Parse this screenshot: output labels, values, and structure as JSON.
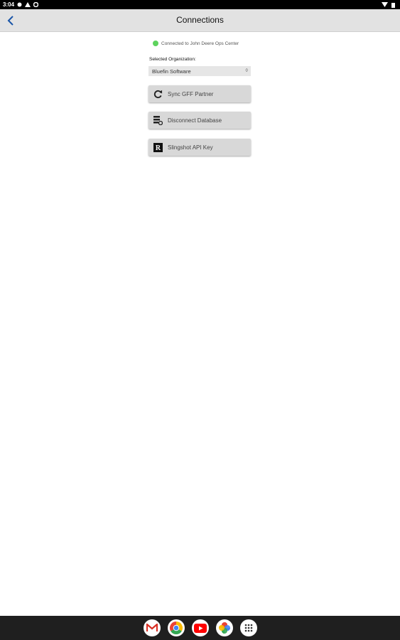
{
  "status_bar": {
    "time": "3:04"
  },
  "header": {
    "title": "Connections",
    "back_icon": "chevron-left-icon"
  },
  "connection": {
    "status_text": "Connected to John Deere Ops Center",
    "status_color": "#5ed35e"
  },
  "organization": {
    "label": "Selected Organization:",
    "value": "Bluefin Software",
    "caret": "◊"
  },
  "buttons": [
    {
      "label": "Sync GFF Partner",
      "icon": "sync-icon"
    },
    {
      "label": "Disconnect Database",
      "icon": "database-disconnect-icon"
    },
    {
      "label": "Slingshot API Key",
      "icon": "slingshot-r-icon"
    }
  ],
  "dock": [
    "gmail-icon",
    "chrome-icon",
    "youtube-icon",
    "photos-icon",
    "app-drawer-icon"
  ]
}
